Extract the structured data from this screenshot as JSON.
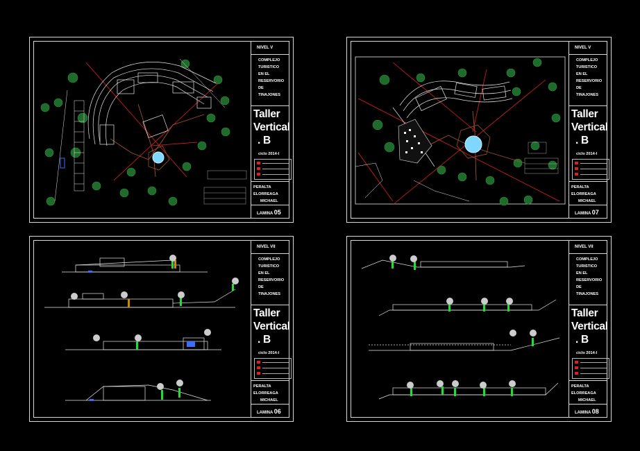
{
  "sheets": [
    {
      "level": "NIVEL V",
      "project": [
        "COMPLEJO",
        "TURISTICO",
        "EN EL",
        "RESERVORIO",
        "DE",
        "TINAJONES"
      ],
      "taller": [
        "Taller",
        "Vertical",
        ". B"
      ],
      "cycle": "ciclo 2014-I",
      "author": [
        "PERALTA ELORREAGA",
        "MICHAEL"
      ],
      "lamina_label": "LAMINA",
      "lamina_num": "05"
    },
    {
      "level": "NIVEL V",
      "project": [
        "COMPLEJO",
        "TURISTICO",
        "EN EL",
        "RESERVORIO",
        "DE",
        "TINAJONES"
      ],
      "taller": [
        "Taller",
        "Vertical",
        ". B"
      ],
      "cycle": "ciclo 2014-I",
      "author": [
        "PERALTA ELORREAGA",
        "MICHAEL"
      ],
      "lamina_label": "LAMINA",
      "lamina_num": "07"
    },
    {
      "level": "NIVEL VII",
      "project": [
        "COMPLEJO",
        "TURISTICO",
        "EN EL",
        "RESERVORIO",
        "DE",
        "TINAJONES"
      ],
      "taller": [
        "Taller",
        "Vertical",
        ". B"
      ],
      "cycle": "ciclo 2014-I",
      "author": [
        "PERALTA ELORREAGA",
        "MICHAEL"
      ],
      "lamina_label": "LAMINA",
      "lamina_num": "06"
    },
    {
      "level": "NIVEL VII",
      "project": [
        "COMPLEJO",
        "TURISTICO",
        "EN EL",
        "RESERVORIO",
        "DE",
        "TINAJONES"
      ],
      "taller": [
        "Taller",
        "Vertical",
        ". B"
      ],
      "cycle": "ciclo 2014-I",
      "author": [
        "PERALTA ELORREAGA",
        "MICHAEL"
      ],
      "lamina_label": "LAMINA",
      "lamina_num": "08"
    }
  ],
  "colors": {
    "background": "#000000",
    "frame": "#d8d8d8",
    "tree": "#1f6b2c",
    "axis": "#e02020",
    "path": "#a0522d",
    "water": "#7fd7ff",
    "green": "#22dd33"
  }
}
